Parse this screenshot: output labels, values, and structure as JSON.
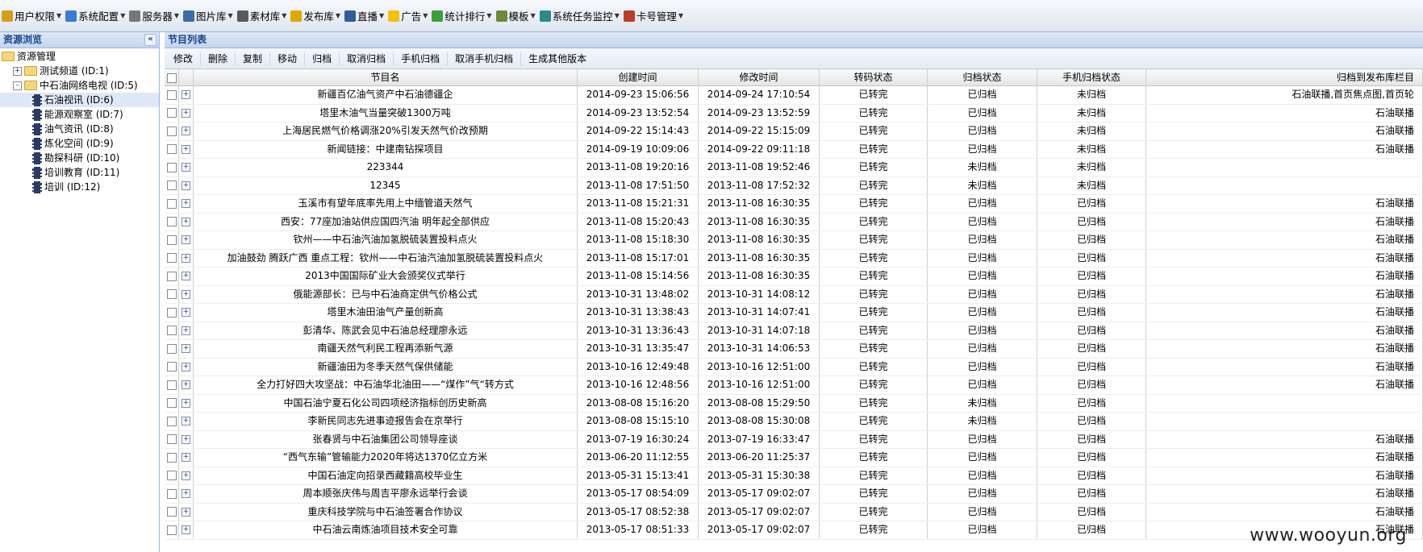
{
  "menu": [
    {
      "label": "用户权限",
      "icon": "user-lock-icon",
      "color": "#d4a017"
    },
    {
      "label": "系统配置",
      "icon": "gears-icon",
      "color": "#3a7bd5"
    },
    {
      "label": "服务器",
      "icon": "server-icon",
      "color": "#777777"
    },
    {
      "label": "图片库",
      "icon": "picture-icon",
      "color": "#3a6ea5"
    },
    {
      "label": "素材库",
      "icon": "film-icon",
      "color": "#5a5a5a"
    },
    {
      "label": "发布库",
      "icon": "publish-folder-icon",
      "color": "#e0a800"
    },
    {
      "label": "直播",
      "icon": "monitor-icon",
      "color": "#2e5c9c"
    },
    {
      "label": "广告",
      "icon": "lightbulb-icon",
      "color": "#f2c200"
    },
    {
      "label": "统计排行",
      "icon": "chart-icon",
      "color": "#3aa03a"
    },
    {
      "label": "模板",
      "icon": "template-icon",
      "color": "#6a8a3a"
    },
    {
      "label": "系统任务监控",
      "icon": "globe-icon",
      "color": "#2a8a8a"
    },
    {
      "label": "卡号管理",
      "icon": "card-icon",
      "color": "#c0392b"
    }
  ],
  "left": {
    "title": "资源浏览",
    "collapse": "«",
    "tree": [
      {
        "label": "资源管理",
        "level": 0,
        "type": "folder",
        "expander": ""
      },
      {
        "label": "测试频道 (ID:1)",
        "level": 1,
        "type": "folder",
        "expander": "+"
      },
      {
        "label": "中石油网络电视 (ID:5)",
        "level": 1,
        "type": "folder",
        "expander": "-"
      },
      {
        "label": "石油视讯 (ID:6)",
        "level": 2,
        "type": "tv",
        "selected": true
      },
      {
        "label": "能源观察室 (ID:7)",
        "level": 2,
        "type": "tv"
      },
      {
        "label": "油气资讯 (ID:8)",
        "level": 2,
        "type": "tv"
      },
      {
        "label": "炼化空间 (ID:9)",
        "level": 2,
        "type": "tv"
      },
      {
        "label": "勘探科研 (ID:10)",
        "level": 2,
        "type": "tv"
      },
      {
        "label": "培训教育 (ID:11)",
        "level": 2,
        "type": "tv"
      },
      {
        "label": "培训 (ID:12)",
        "level": 2,
        "type": "tv"
      }
    ]
  },
  "main": {
    "title": "节目列表",
    "toolbar": [
      "修改",
      "删除",
      "复制",
      "移动",
      "归档",
      "取消归档",
      "手机归档",
      "取消手机归档",
      "生成其他版本"
    ],
    "columns": [
      "节目名",
      "创建时间",
      "修改时间",
      "转码状态",
      "归档状态",
      "手机归档状态",
      "归档到发布库栏目"
    ],
    "rows": [
      [
        "新疆百亿油气资产中石油德疆企",
        "2014-09-23 15:06:56",
        "2014-09-24 17:10:54",
        "已转完",
        "已归档",
        "未归档",
        "石油联播,首页焦点图,首页轮"
      ],
      [
        "塔里木油气当量突破1300万吨",
        "2014-09-23 13:52:54",
        "2014-09-23 13:52:59",
        "已转完",
        "已归档",
        "未归档",
        "石油联播"
      ],
      [
        "上海居民燃气价格调涨20%引发天然气价改预期",
        "2014-09-22 15:14:43",
        "2014-09-22 15:15:09",
        "已转完",
        "已归档",
        "未归档",
        "石油联播"
      ],
      [
        "新闻链接：中建南钻探项目",
        "2014-09-19 10:09:06",
        "2014-09-22 09:11:18",
        "已转完",
        "已归档",
        "未归档",
        "石油联播"
      ],
      [
        "223344",
        "2013-11-08 19:20:16",
        "2013-11-08 19:52:46",
        "已转完",
        "未归档",
        "未归档",
        ""
      ],
      [
        "12345",
        "2013-11-08 17:51:50",
        "2013-11-08 17:52:32",
        "已转完",
        "未归档",
        "未归档",
        ""
      ],
      [
        "玉溪市有望年底率先用上中缅管道天然气",
        "2013-11-08 15:21:31",
        "2013-11-08 16:30:35",
        "已转完",
        "已归档",
        "已归档",
        "石油联播"
      ],
      [
        "西安：77座加油站供应国四汽油 明年起全部供应",
        "2013-11-08 15:20:43",
        "2013-11-08 16:30:35",
        "已转完",
        "已归档",
        "已归档",
        "石油联播"
      ],
      [
        "钦州——中石油汽油加氢脱硫装置投料点火",
        "2013-11-08 15:18:30",
        "2013-11-08 16:30:35",
        "已转完",
        "已归档",
        "已归档",
        "石油联播"
      ],
      [
        "加油鼓劲 腾跃广西 重点工程：钦州——中石油汽油加氢脱硫装置投料点火",
        "2013-11-08 15:17:01",
        "2013-11-08 16:30:35",
        "已转完",
        "已归档",
        "已归档",
        "石油联播"
      ],
      [
        "2013中国国际矿业大会颁奖仪式举行",
        "2013-11-08 15:14:56",
        "2013-11-08 16:30:35",
        "已转完",
        "已归档",
        "已归档",
        "石油联播"
      ],
      [
        "俄能源部长：已与中石油商定供气价格公式",
        "2013-10-31 13:48:02",
        "2013-10-31 14:08:12",
        "已转完",
        "已归档",
        "已归档",
        "石油联播"
      ],
      [
        "塔里木油田油气产量创新高",
        "2013-10-31 13:38:43",
        "2013-10-31 14:07:41",
        "已转完",
        "已归档",
        "已归档",
        "石油联播"
      ],
      [
        "彭清华、陈武会见中石油总经理廖永远",
        "2013-10-31 13:36:43",
        "2013-10-31 14:07:18",
        "已转完",
        "已归档",
        "已归档",
        "石油联播"
      ],
      [
        "南疆天然气利民工程再添新气源",
        "2013-10-31 13:35:47",
        "2013-10-31 14:06:53",
        "已转完",
        "已归档",
        "已归档",
        "石油联播"
      ],
      [
        "新疆油田为冬季天然气保供储能",
        "2013-10-16 12:49:48",
        "2013-10-16 12:51:00",
        "已转完",
        "已归档",
        "已归档",
        "石油联播"
      ],
      [
        "全力打好四大攻坚战：中石油华北油田——“煤作”气“转方式",
        "2013-10-16 12:48:56",
        "2013-10-16 12:51:00",
        "已转完",
        "已归档",
        "已归档",
        "石油联播"
      ],
      [
        "中国石油宁夏石化公司四项经济指标创历史新高",
        "2013-08-08 15:16:20",
        "2013-08-08 15:29:50",
        "已转完",
        "未归档",
        "已归档",
        ""
      ],
      [
        "李新民同志先进事迹报告会在京举行",
        "2013-08-08 15:15:10",
        "2013-08-08 15:30:08",
        "已转完",
        "未归档",
        "已归档",
        ""
      ],
      [
        "张春贤与中石油集团公司领导座谈",
        "2013-07-19 16:30:24",
        "2013-07-19 16:33:47",
        "已转完",
        "已归档",
        "已归档",
        "石油联播"
      ],
      [
        "“西气东输”管输能力2020年将达1370亿立方米",
        "2013-06-20 11:12:55",
        "2013-06-20 11:25:37",
        "已转完",
        "已归档",
        "已归档",
        "石油联播"
      ],
      [
        "中国石油定向招录西藏籍高校毕业生",
        "2013-05-31 15:13:41",
        "2013-05-31 15:30:38",
        "已转完",
        "已归档",
        "已归档",
        "石油联播"
      ],
      [
        "周本顺张庆伟与周吉平廖永远举行会谈",
        "2013-05-17 08:54:09",
        "2013-05-17 09:02:07",
        "已转完",
        "已归档",
        "已归档",
        "石油联播"
      ],
      [
        "重庆科技学院与中石油签署合作协议",
        "2013-05-17 08:52:38",
        "2013-05-17 09:02:07",
        "已转完",
        "已归档",
        "已归档",
        "石油联播"
      ],
      [
        "中石油云南炼油项目技术安全可靠",
        "2013-05-17 08:51:33",
        "2013-05-17 09:02:07",
        "已转完",
        "已归档",
        "已归档",
        "石油联播"
      ]
    ]
  },
  "watermark": "www.wooyun.org"
}
